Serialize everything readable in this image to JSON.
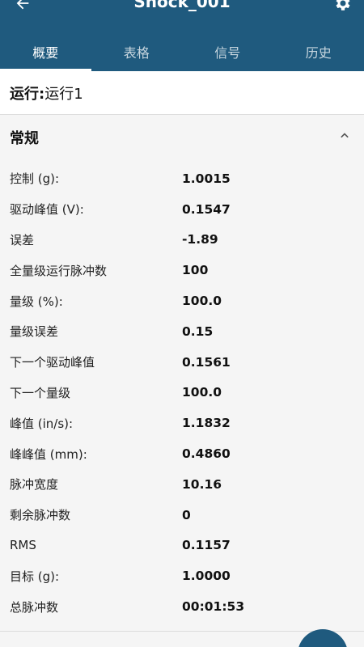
{
  "app_bar": {
    "title": "Shock_001",
    "icons": {
      "back": "arrow-back-icon",
      "settings": "gear-icon"
    },
    "colors": {
      "primary": "#1f5a7e"
    }
  },
  "tabs": [
    {
      "label": "概要",
      "active": true
    },
    {
      "label": "表格",
      "active": false
    },
    {
      "label": "信号",
      "active": false
    },
    {
      "label": "历史",
      "active": false
    }
  ],
  "run": {
    "label": "运行:",
    "value": "运行1"
  },
  "section": {
    "title": "常规",
    "icon": "chevron-up-icon"
  },
  "params": [
    {
      "key": "控制 (g):",
      "value": "1.0015"
    },
    {
      "key": "驱动峰值 (V):",
      "value": "0.1547"
    },
    {
      "key": "误差",
      "value": "-1.89"
    },
    {
      "key": "全量级运行脉冲数",
      "value": "100"
    },
    {
      "key": "量级 (%):",
      "value": "100.0"
    },
    {
      "key": "量级误差",
      "value": "0.15"
    },
    {
      "key": "下一个驱动峰值",
      "value": "0.1561"
    },
    {
      "key": "下一个量级",
      "value": "100.0"
    },
    {
      "key": "峰值 (in/s):",
      "value": "1.1832"
    },
    {
      "key": "峰峰值 (mm):",
      "value": "0.4860"
    },
    {
      "key": "脉冲宽度",
      "value": "10.16"
    },
    {
      "key": "剩余脉冲数",
      "value": "0"
    },
    {
      "key": "RMS",
      "value": "0.1157"
    },
    {
      "key": "目标 (g):",
      "value": "1.0000"
    },
    {
      "key": "总脉冲数",
      "value": "00:01:53"
    }
  ]
}
